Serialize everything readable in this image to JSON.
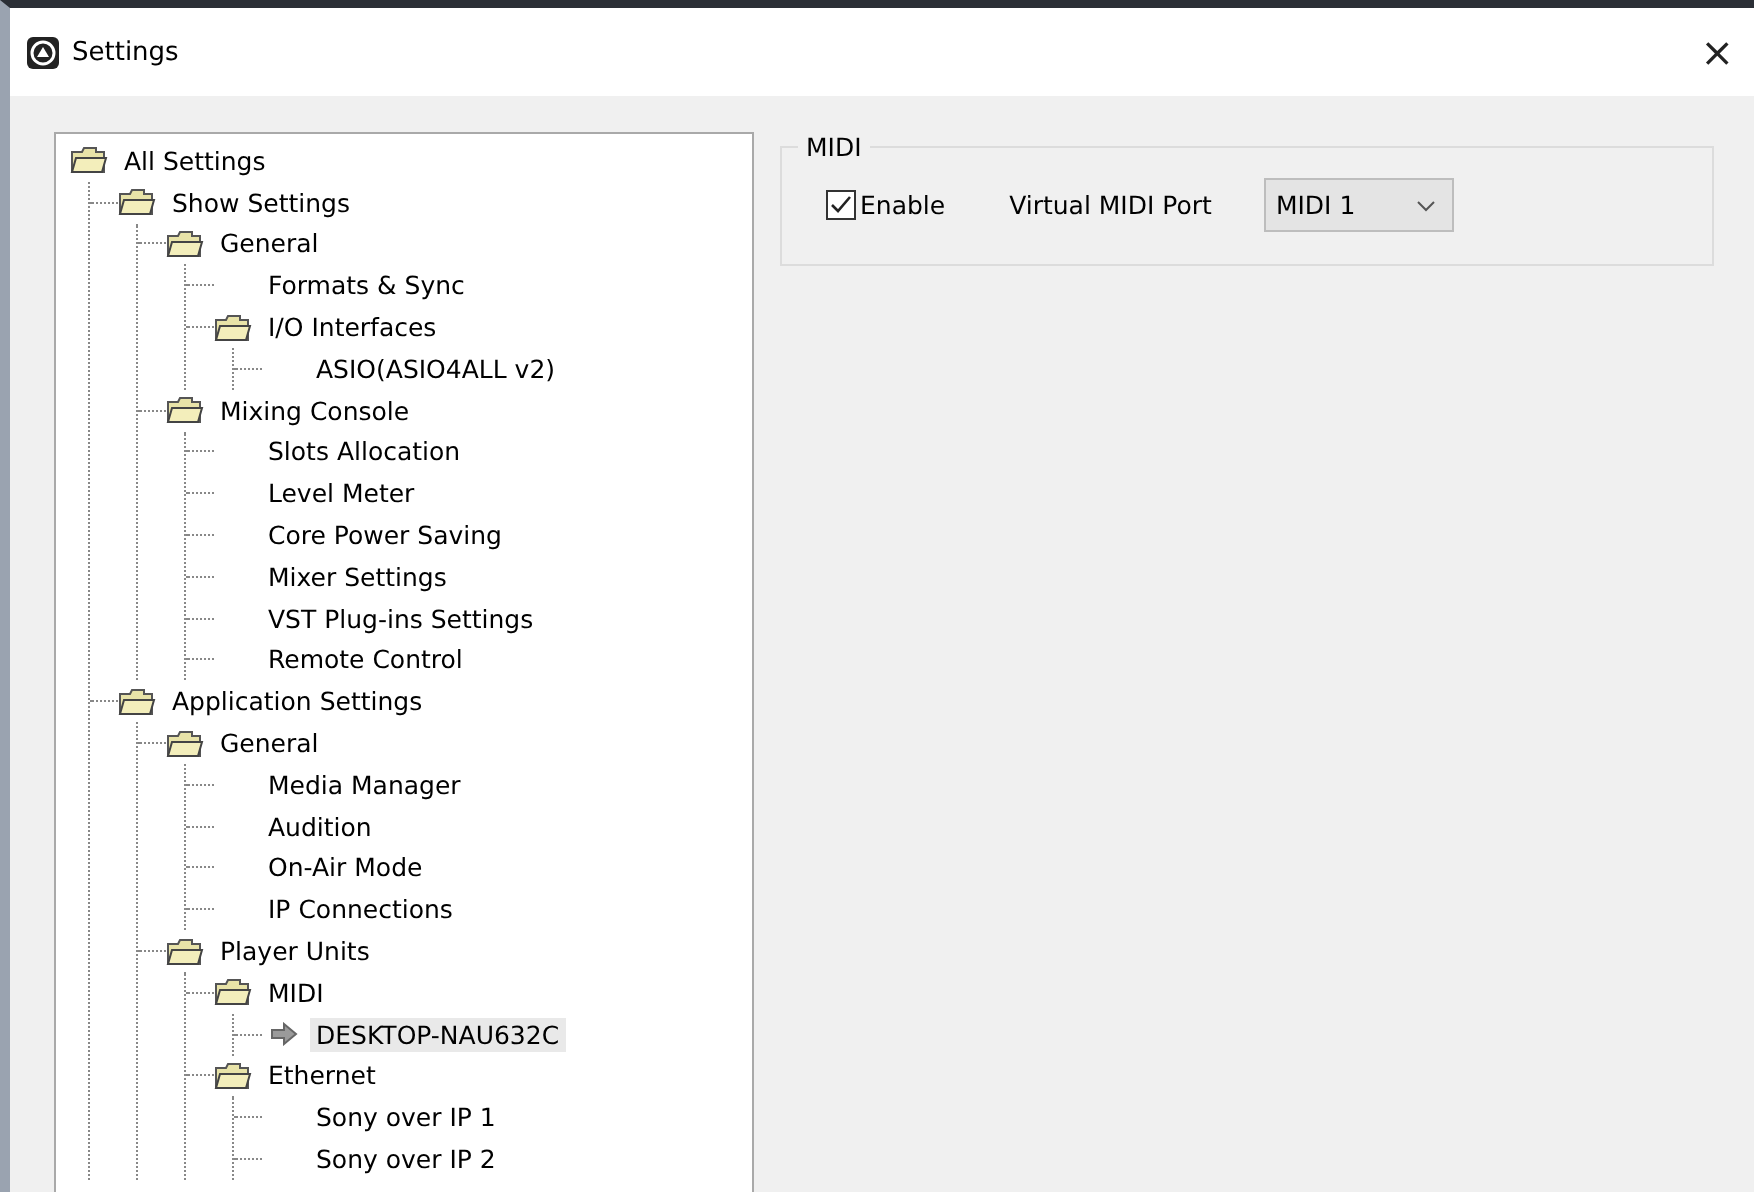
{
  "window": {
    "title": "Settings",
    "close_label": "×"
  },
  "tree": [
    {
      "label": "All Settings",
      "kind": "folder",
      "selected": false,
      "children": [
        {
          "label": "Show Settings",
          "kind": "folder",
          "selected": false,
          "children": [
            {
              "label": "General",
              "kind": "folder",
              "selected": false,
              "children": [
                {
                  "label": "Formats & Sync",
                  "kind": "leaf",
                  "selected": false
                },
                {
                  "label": "I/O Interfaces",
                  "kind": "folder",
                  "selected": false,
                  "children": [
                    {
                      "label": "ASIO(ASIO4ALL v2)",
                      "kind": "leaf",
                      "selected": false
                    }
                  ]
                }
              ]
            },
            {
              "label": "Mixing Console",
              "kind": "folder",
              "selected": false,
              "children": [
                {
                  "label": "Slots Allocation",
                  "kind": "leaf",
                  "selected": false
                },
                {
                  "label": "Level Meter",
                  "kind": "leaf",
                  "selected": false
                },
                {
                  "label": "Core Power Saving",
                  "kind": "leaf",
                  "selected": false
                },
                {
                  "label": "Mixer Settings",
                  "kind": "leaf",
                  "selected": false
                },
                {
                  "label": "VST Plug-ins Settings",
                  "kind": "leaf",
                  "selected": false
                },
                {
                  "label": "Remote Control",
                  "kind": "leaf",
                  "selected": false
                }
              ]
            }
          ]
        },
        {
          "label": "Application Settings",
          "kind": "folder",
          "selected": false,
          "children": [
            {
              "label": "General",
              "kind": "folder",
              "selected": false,
              "children": [
                {
                  "label": "Media Manager",
                  "kind": "leaf",
                  "selected": false
                },
                {
                  "label": "Audition",
                  "kind": "leaf",
                  "selected": false
                },
                {
                  "label": "On-Air Mode",
                  "kind": "leaf",
                  "selected": false
                },
                {
                  "label": "IP Connections",
                  "kind": "leaf",
                  "selected": false
                }
              ]
            },
            {
              "label": "Player Units",
              "kind": "folder",
              "selected": false,
              "children": [
                {
                  "label": "MIDI",
                  "kind": "folder",
                  "selected": false,
                  "children": [
                    {
                      "label": "DESKTOP-NAU632C",
                      "kind": "arrow",
                      "selected": true
                    }
                  ]
                },
                {
                  "label": "Ethernet",
                  "kind": "folder",
                  "selected": false,
                  "children": [
                    {
                      "label": "Sony over IP 1",
                      "kind": "leaf",
                      "selected": false
                    },
                    {
                      "label": "Sony over IP 2",
                      "kind": "leaf",
                      "selected": false
                    }
                  ]
                }
              ]
            }
          ]
        }
      ]
    }
  ],
  "midi_group": {
    "title": "MIDI",
    "enable": {
      "label": "Enable",
      "checked": true
    },
    "port_label": "Virtual MIDI Port",
    "port_value": "MIDI 1"
  }
}
